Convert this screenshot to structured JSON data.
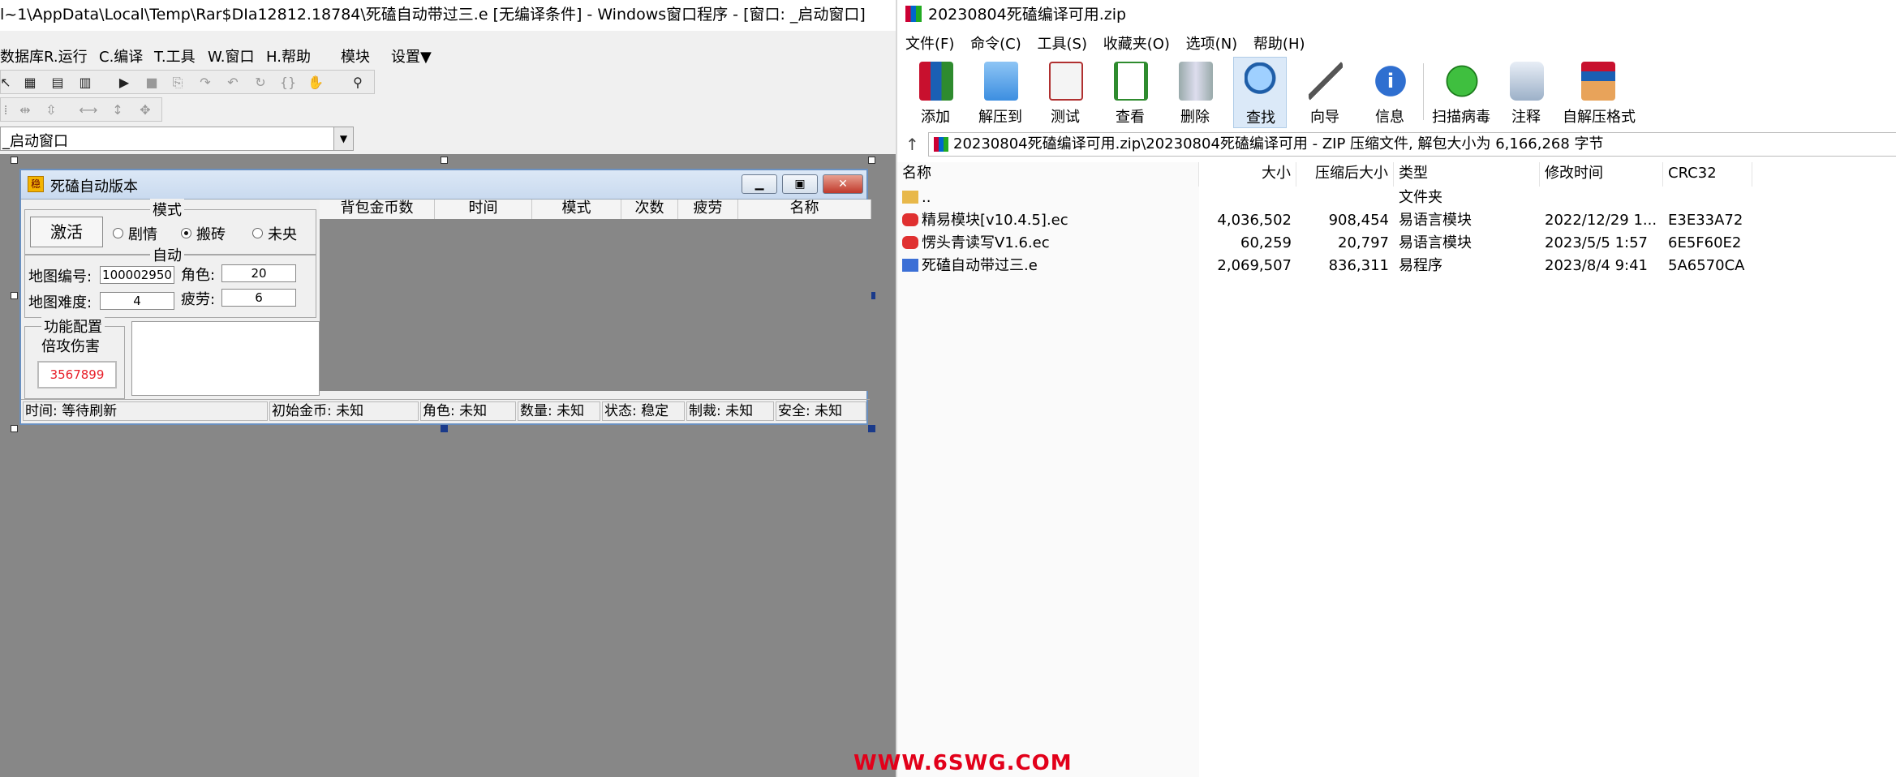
{
  "ide": {
    "title": "l~1\\AppData\\Local\\Temp\\Rar$DIa12812.18784\\死磕自动带过三.e [无编译条件] - Windows窗口程序 - [窗口: _启动窗口]",
    "menu": [
      "数据库",
      "R.运行",
      "C.编译",
      "T.工具",
      "W.窗口",
      "H.帮助",
      "模块",
      "设置▼"
    ],
    "combo_value": "_启动窗口",
    "form": {
      "title": "死磕自动版本",
      "mode_group": "模式",
      "activate_button": "激活",
      "radios": [
        {
          "label": "剧情",
          "checked": false
        },
        {
          "label": "搬砖",
          "checked": true
        },
        {
          "label": "未央",
          "checked": false
        }
      ],
      "auto_group": "自动",
      "map_no_label": "地图编号:",
      "map_no_value": "100002950",
      "role_label": "角色:",
      "role_value": "20",
      "map_diff_label": "地图难度:",
      "map_diff_value": "4",
      "fatigue_label": "疲劳:",
      "fatigue_value": "6",
      "func_group": "功能配置",
      "multi_damage_label": "倍攻伤害",
      "damage_value": "3567899",
      "columns": [
        "背包金币数",
        "时间",
        "模式",
        "次数",
        "疲劳",
        "名称"
      ],
      "status": [
        "时间: 等待刷新",
        "初始金币: 未知",
        "角色: 未知",
        "数量: 未知",
        "状态: 稳定",
        "制裁: 未知",
        "安全: 未知"
      ]
    }
  },
  "zip": {
    "title": "20230804死磕编译可用.zip",
    "menu": [
      "文件(F)",
      "命令(C)",
      "工具(S)",
      "收藏夹(O)",
      "选项(N)",
      "帮助(H)"
    ],
    "toolbar": [
      "添加",
      "解压到",
      "测试",
      "查看",
      "删除",
      "查找",
      "向导",
      "信息",
      "扫描病毒",
      "注释",
      "自解压格式"
    ],
    "address": "20230804死磕编译可用.zip\\20230804死磕编译可用 - ZIP 压缩文件, 解包大小为 6,166,268 字节",
    "columns": [
      "名称",
      "大小",
      "压缩后大小",
      "类型",
      "修改时间",
      "CRC32"
    ],
    "rows": [
      {
        "name": "..",
        "size": "",
        "packed": "",
        "type": "文件夹",
        "modified": "",
        "crc": ""
      },
      {
        "name": "精易模块[v10.4.5].ec",
        "size": "4,036,502",
        "packed": "908,454",
        "type": "易语言模块",
        "modified": "2022/12/29 1...",
        "crc": "E3E33A72"
      },
      {
        "name": "愣头青读写V1.6.ec",
        "size": "60,259",
        "packed": "20,797",
        "type": "易语言模块",
        "modified": "2023/5/5 1:57",
        "crc": "6E5F60E2"
      },
      {
        "name": "死磕自动带过三.e",
        "size": "2,069,507",
        "packed": "836,311",
        "type": "易程序",
        "modified": "2023/8/4 9:41",
        "crc": "5A6570CA"
      }
    ]
  },
  "watermark": "WWW.6SWG.COM"
}
